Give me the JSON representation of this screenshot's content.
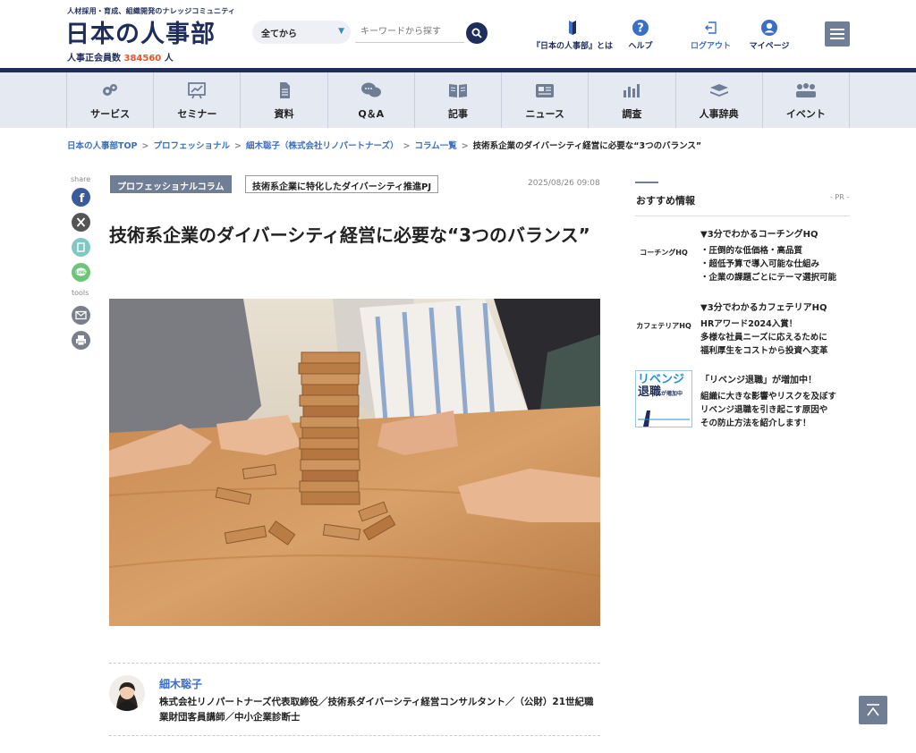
{
  "header": {
    "tagline": "人材採用・育成、組織開発のナレッジコミュニティ",
    "logo": "日本の人事部",
    "members_label": "人事正会員数",
    "members_count": "384560",
    "members_unit": "人",
    "search_scope": "全てから",
    "search_placeholder": "キーワードから探す",
    "nav": {
      "about": "『日本の人事部』とは",
      "help": "ヘルプ",
      "logout": "ログアウト",
      "mypage": "マイページ"
    }
  },
  "categories": [
    {
      "label": "サービス",
      "icon": "service-icon"
    },
    {
      "label": "セミナー",
      "icon": "seminar-icon"
    },
    {
      "label": "資料",
      "icon": "document-icon"
    },
    {
      "label": "Q＆A",
      "icon": "qa-icon"
    },
    {
      "label": "記事",
      "icon": "article-icon"
    },
    {
      "label": "ニュース",
      "icon": "news-icon"
    },
    {
      "label": "調査",
      "icon": "survey-icon"
    },
    {
      "label": "人事辞典",
      "icon": "dictionary-icon"
    },
    {
      "label": "イベント",
      "icon": "event-icon"
    }
  ],
  "breadcrumb": {
    "items": [
      "日本の人事部TOP",
      "プロフェッショナル",
      "細木聡子（株式会社リノパートナーズ）",
      "コラム一覧"
    ],
    "current": "技術系企業のダイバーシティ経営に必要な“3つのバランス”"
  },
  "share": {
    "share_label": "share",
    "tools_label": "tools"
  },
  "article": {
    "tag_primary": "プロフェッショナルコラム",
    "tag_secondary": "技術系企業に特化したダイバーシティ推進PJ",
    "date": "2025/08/26 09:08",
    "title": "技術系企業のダイバーシティ経営に必要な“3つのバランス”"
  },
  "author": {
    "name": "細木聡子",
    "bio": "株式会社リノパートナーズ代表取締役／技術系ダイバーシティ経営コンサルタント／（公財）21世紀職業財団客員講師／中小企業診断士"
  },
  "sidebar": {
    "heading": "おすすめ情報",
    "pr": "- PR -",
    "promos": [
      {
        "logo": "コーチングHQ",
        "title": "▼3分でわかるコーチングHQ",
        "lines": [
          "・圧倒的な低価格・高品質",
          "・超低予算で導入可能な仕組み",
          "・企業の課題ごとにテーマ選択可能"
        ]
      },
      {
        "logo": "カフェテリアHQ",
        "title": "▼3分でわかるカフェテリアHQ",
        "lines": [
          "HRアワード2024入賞！",
          "多様な社員ニーズに応えるために",
          "福利厚生をコストから投資へ変革"
        ]
      },
      {
        "logo_line1": "リベンジ",
        "logo_line2": "退職",
        "logo_line3": "が増加中",
        "title": "「リベンジ退職」が増加中！",
        "lines": [
          "組織に大きな影響やリスクを及ぼす",
          "リベンジ退職を引き起こす原因や",
          "その防止方法を紹介します！"
        ]
      }
    ]
  },
  "colors": {
    "brand_navy": "#1f2d5c",
    "link_blue": "#3a6fc4",
    "accent_orange": "#e8542b",
    "tag_gray": "#6f7d95"
  }
}
